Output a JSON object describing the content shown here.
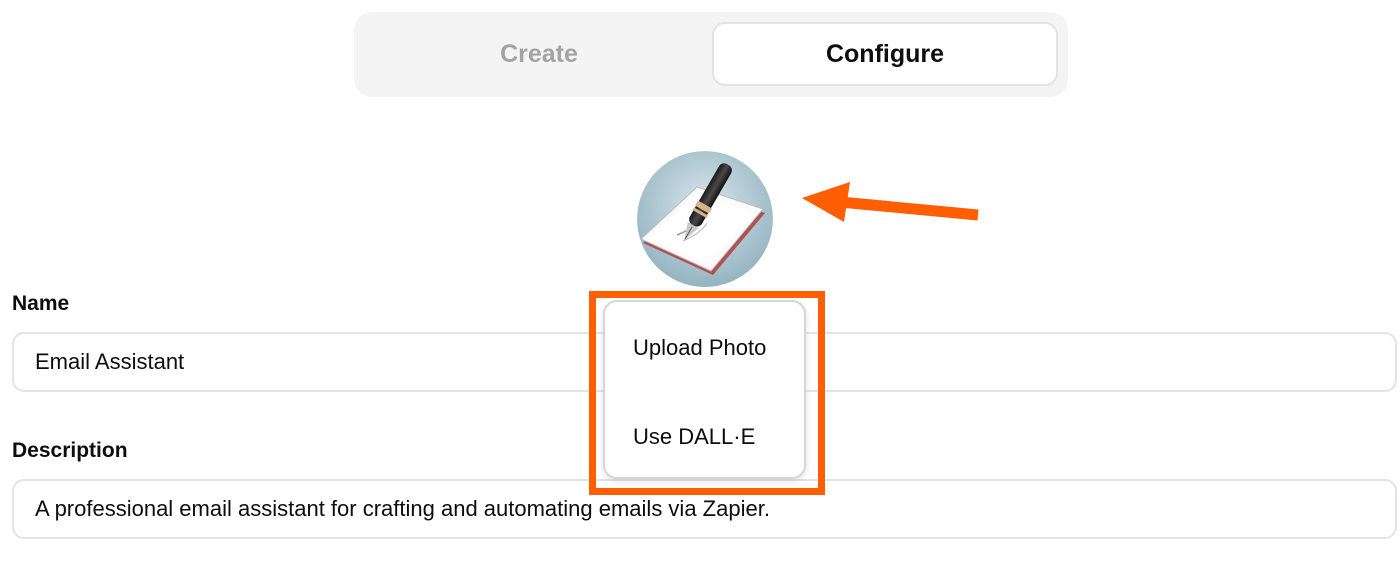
{
  "tabs": {
    "create_label": "Create",
    "configure_label": "Configure",
    "active": "Configure"
  },
  "avatar": {
    "icon": "pen-and-notepad-icon"
  },
  "annotation": {
    "color": "#ff5f00"
  },
  "menu": {
    "items": [
      {
        "label": "Upload Photo"
      },
      {
        "label": "Use DALL·E"
      }
    ]
  },
  "form": {
    "name": {
      "label": "Name",
      "value": "Email Assistant"
    },
    "description": {
      "label": "Description",
      "value": "A professional email assistant for crafting and automating emails via Zapier."
    }
  }
}
